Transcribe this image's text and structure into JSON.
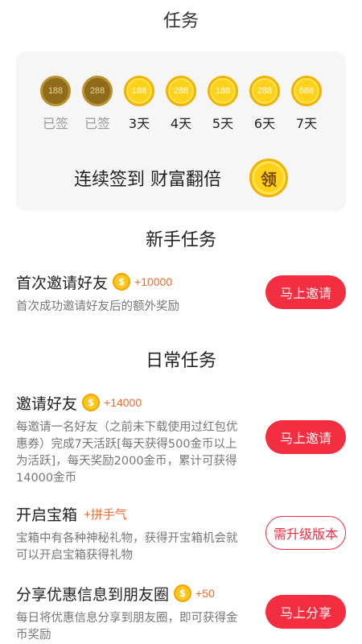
{
  "header": {
    "title": "任务"
  },
  "checkin": {
    "days": [
      {
        "coin": "188",
        "label": "已签",
        "state": "done"
      },
      {
        "coin": "288",
        "label": "已签",
        "state": "done"
      },
      {
        "coin": "188",
        "label": "3天",
        "state": "todo"
      },
      {
        "coin": "288",
        "label": "4天",
        "state": "todo"
      },
      {
        "coin": "188",
        "label": "5天",
        "state": "todo"
      },
      {
        "coin": "288",
        "label": "6天",
        "state": "todo"
      },
      {
        "coin": "688",
        "label": "7天",
        "state": "todo"
      }
    ],
    "claim_text": "连续签到 财富翻倍",
    "claim_button": "领"
  },
  "newbie": {
    "title": "新手任务",
    "tasks": [
      {
        "name": "首次邀请好友",
        "reward": "+10000",
        "desc": "首次成功邀请好友后的额外奖励",
        "button": "马上邀请"
      }
    ]
  },
  "daily": {
    "title": "日常任务",
    "tasks": [
      {
        "name": "邀请好友",
        "reward": "+14000",
        "desc": "每邀请一名好友（之前未下载使用过红包优惠券）完成7天活跃[每天获得500金币以上为活跃]，每天奖励2000金币，累计可获得14000金币",
        "button": "马上邀请"
      },
      {
        "name": "开启宝箱",
        "reward": "+拼手气",
        "desc": "宝箱中有各种神秘礼物，获得开宝箱机会就可以开启宝箱获得礼物",
        "button": "需升级版本"
      },
      {
        "name": "分享优惠信息到朋友圈",
        "reward": "+50",
        "desc": "每日将优惠信息分享到朋友圈，即可获得金币奖励",
        "button": "马上分享"
      }
    ]
  },
  "colors": {
    "accent": "#f22e40",
    "coin": "#ffd21a",
    "reward": "#f06a2d"
  },
  "icons": {
    "coin": "coin-icon"
  }
}
